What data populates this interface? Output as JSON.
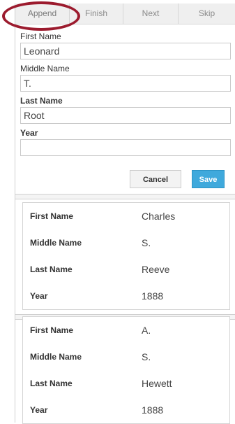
{
  "toolbar": {
    "append_label": "Append",
    "finish_label": "Finish",
    "next_label": "Next",
    "skip_label": "Skip"
  },
  "form": {
    "first_name_label": "First Name",
    "first_name_value": "Leonard",
    "middle_name_label": "Middle Name",
    "middle_name_value": "T.",
    "last_name_label": "Last Name",
    "last_name_value": "Root",
    "year_label": "Year",
    "year_value": "",
    "cancel_label": "Cancel",
    "save_label": "Save"
  },
  "records": [
    {
      "first_name_label": "First Name",
      "first_name_value": "Charles",
      "middle_name_label": "Middle Name",
      "middle_name_value": "S.",
      "last_name_label": "Last Name",
      "last_name_value": "Reeve",
      "year_label": "Year",
      "year_value": "1888"
    },
    {
      "first_name_label": "First Name",
      "first_name_value": "A.",
      "middle_name_label": "Middle Name",
      "middle_name_value": "S.",
      "last_name_label": "Last Name",
      "last_name_value": "Hewett",
      "year_label": "Year",
      "year_value": "1888"
    }
  ],
  "colors": {
    "highlight_circle": "#9c1b2e",
    "save_button": "#3fa9dc"
  }
}
